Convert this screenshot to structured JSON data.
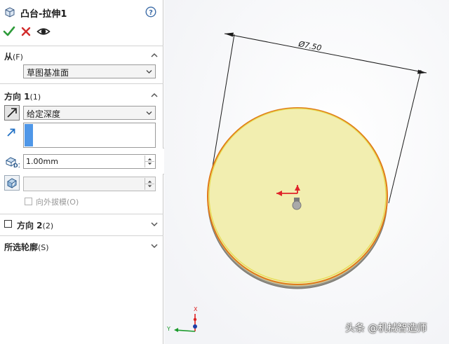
{
  "feature": {
    "title": "凸台-拉伸1",
    "help_icon": "help-question-icon",
    "feature_icon": "boss-extrude-icon"
  },
  "actions": {
    "ok_icon": "checkmark-icon",
    "cancel_icon": "close-icon",
    "preview_icon": "eye-icon"
  },
  "from_section": {
    "label": "从",
    "shortcut": "(F)",
    "selected": "草图基准面"
  },
  "direction1": {
    "label": "方向 1",
    "shortcut": "(1)",
    "end_condition": "给定深度",
    "depth": "1.00mm",
    "draft_outward_label": "向外拔模(O)"
  },
  "direction2": {
    "label": "方向 2",
    "shortcut": "(2)",
    "checked": false
  },
  "selected_contours": {
    "label": "所选轮廓",
    "shortcut": "(S)"
  },
  "viewport": {
    "dimension": "Ø7.50",
    "triad_x": "X",
    "triad_y": "Y",
    "accent_edge": "#e07a18",
    "face_fill": "#f2eeb0"
  },
  "watermark": "头条 @机械智造师"
}
